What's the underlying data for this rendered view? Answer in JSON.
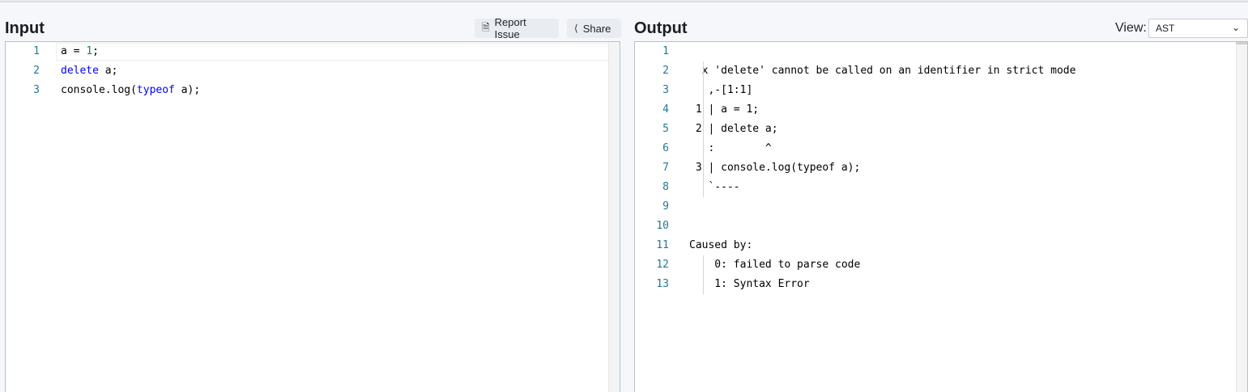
{
  "input": {
    "title": "Input",
    "report_issue_label": "Report Issue",
    "share_label": "Share",
    "lines": [
      {
        "num": "1"
      },
      {
        "num": "2"
      },
      {
        "num": "3"
      }
    ],
    "code": {
      "l1_a": "a = ",
      "l1_num": "1",
      "l1_end": ";",
      "l2_kw": "delete",
      "l2_rest": " a;",
      "l3_a": "console.log(",
      "l3_kw": "typeof",
      "l3_b": " a);"
    }
  },
  "output": {
    "title": "Output",
    "view_label": "View:",
    "view_selected": "AST",
    "line_numbers": [
      "1",
      "2",
      "3",
      "4",
      "5",
      "6",
      "7",
      "8",
      "9",
      "10",
      "11",
      "12",
      "13"
    ],
    "lines": [
      "",
      "  x 'delete' cannot be called on an identifier in strict mode",
      "   ,-[1:1]",
      " 1 | a = 1;",
      " 2 | delete a;",
      "   :        ^",
      " 3 | console.log(typeof a);",
      "   `----",
      "",
      "",
      "Caused by:",
      "    0: failed to parse code",
      "    1: Syntax Error"
    ]
  },
  "icons": {
    "report": "document-icon",
    "share": "share-icon",
    "chevron": "chevron-down-icon"
  }
}
